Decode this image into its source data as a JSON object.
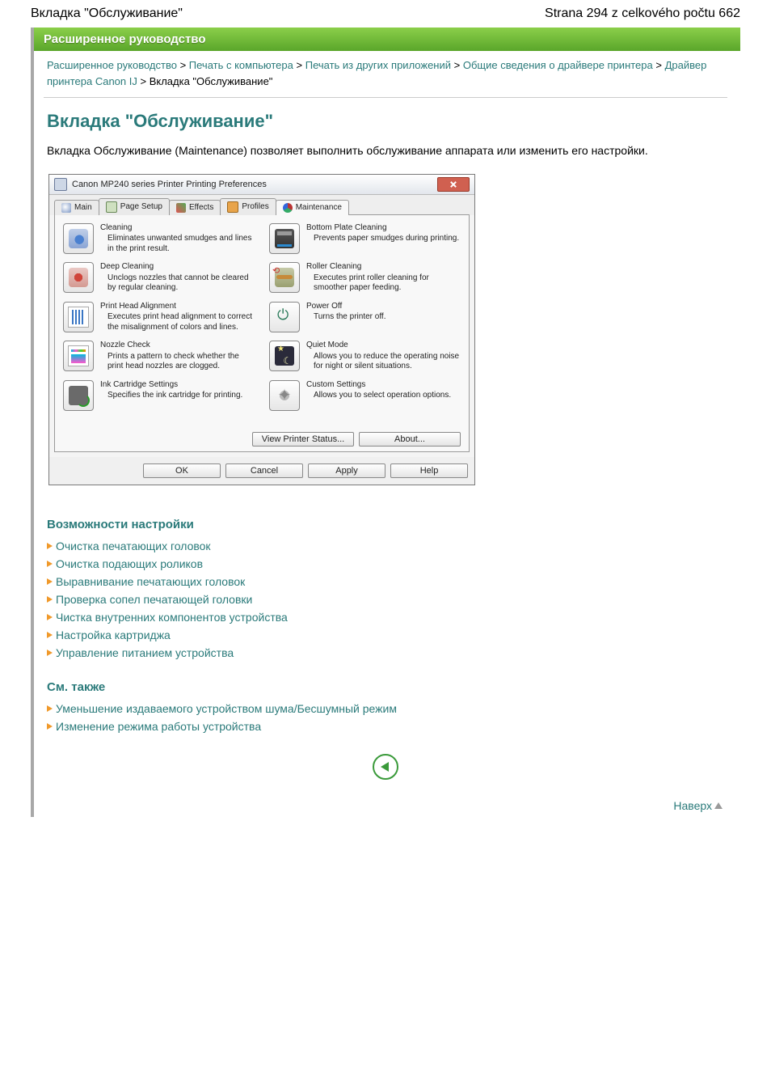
{
  "header": {
    "left": "Вкладка \"Обслуживание\"",
    "right": "Strana 294 z celkového počtu 662"
  },
  "bar_title": "Расширенное руководство",
  "breadcrumb": {
    "items": [
      "Расширенное руководство",
      "Печать с компьютера",
      "Печать из других приложений",
      "Общие сведения о драйвере принтера",
      "Драйвер принтера Canon IJ"
    ],
    "current": "Вкладка \"Обслуживание\"",
    "sep": ">"
  },
  "page_title": "Вкладка \"Обслуживание\"",
  "lead": "Вкладка Обслуживание (Maintenance) позволяет выполнить обслуживание аппарата или изменить его настройки.",
  "dialog": {
    "title": "Canon MP240 series Printer Printing Preferences",
    "tabs": [
      "Main",
      "Page Setup",
      "Effects",
      "Profiles",
      "Maintenance"
    ],
    "active_tab": 4,
    "left": [
      {
        "title": "Cleaning",
        "desc": "Eliminates unwanted smudges and lines in the print result."
      },
      {
        "title": "Deep Cleaning",
        "desc": "Unclogs nozzles that cannot be cleared by regular cleaning."
      },
      {
        "title": "Print Head Alignment",
        "desc": "Executes print head alignment to correct the misalignment of colors and lines."
      },
      {
        "title": "Nozzle Check",
        "desc": "Prints a pattern to check whether the print head nozzles are clogged."
      },
      {
        "title": "Ink Cartridge Settings",
        "desc": "Specifies the ink cartridge for printing."
      }
    ],
    "right": [
      {
        "title": "Bottom Plate Cleaning",
        "desc": "Prevents paper smudges during printing."
      },
      {
        "title": "Roller Cleaning",
        "desc": "Executes print roller cleaning for smoother paper feeding."
      },
      {
        "title": "Power Off",
        "desc": "Turns the printer off."
      },
      {
        "title": "Quiet Mode",
        "desc": "Allows you to reduce the operating noise for night or silent situations."
      },
      {
        "title": "Custom Settings",
        "desc": "Allows you to select operation options."
      }
    ],
    "btn_status": "View Printer Status...",
    "btn_about": "About...",
    "footer": [
      "OK",
      "Cancel",
      "Apply",
      "Help"
    ]
  },
  "sec1_title": "Возможности настройки",
  "sec1_links": [
    "Очистка печатающих головок",
    "Очистка подающих роликов",
    "Выравнивание печатающих головок",
    "Проверка сопел печатающей головки",
    "Чистка внутренних компонентов устройства",
    "Настройка картриджа",
    "Управление питанием устройства"
  ],
  "sec2_title": "См. также",
  "sec2_links": [
    "Уменьшение издаваемого устройством шума/Бесшумный режим",
    "Изменение режима работы устройства"
  ],
  "top_link": "Наверх"
}
